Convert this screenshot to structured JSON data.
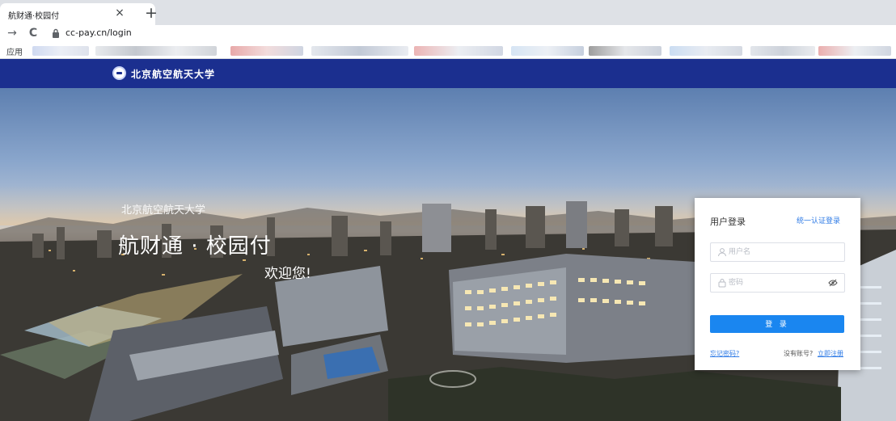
{
  "browser": {
    "tab_title": "航财通·校园付",
    "tab_close_glyph": "×",
    "new_tab_glyph": "+",
    "back_glyph": "→",
    "reload_glyph": "C",
    "url": "cc-pay.cn/login",
    "bookmarks_apps_label": "应用"
  },
  "header": {
    "logo_text": "北京航空航天大学"
  },
  "hero": {
    "university": "北京航空航天大学",
    "title": "航财通 · 校园付",
    "welcome": "欢迎您!"
  },
  "login": {
    "title": "用户登录",
    "sso_link": "统一认证登录",
    "username_placeholder": "用户名",
    "password_placeholder": "密码",
    "submit_label": "登 录",
    "forgot_link": "忘记密码?",
    "no_account_text": "没有账号?",
    "register_link": "立即注册"
  },
  "colors": {
    "brand_navy": "#1b2f8f",
    "button_blue": "#1a86f0",
    "link_blue": "#2f7be6"
  }
}
